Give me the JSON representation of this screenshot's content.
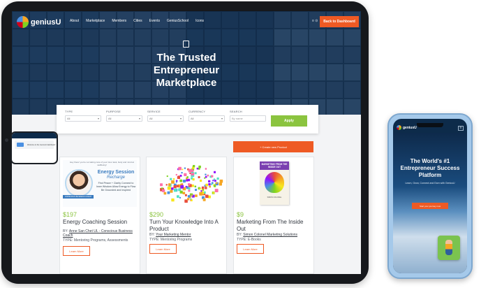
{
  "tablet": {
    "nav": {
      "logo_text": "geniusU",
      "links": [
        "About",
        "Marketplace",
        "Members",
        "Cities",
        "Events",
        "GeniusSchool",
        "Icons"
      ],
      "icons_text": "≡  ⊙",
      "cta_label": "Back to Dashboard"
    },
    "hero": {
      "title_lines": [
        "The Trusted",
        "Entrepreneur",
        "Marketplace"
      ]
    },
    "filters": {
      "type": {
        "label": "TYPE",
        "value": "All"
      },
      "purpose": {
        "label": "PURPOSE",
        "value": "All"
      },
      "service": {
        "label": "SERVICE",
        "value": "All"
      },
      "currency": {
        "label": "CURRENCY",
        "value": "All"
      },
      "search": {
        "label": "SEARCH",
        "placeholder": "By name"
      },
      "apply_label": "Apply"
    },
    "create_label": "+ Create new Product",
    "products": [
      {
        "price": "$197",
        "title": "Energy Coaching Session",
        "by_label": "BY:",
        "author": "Anne San Chet UL - Conscious Business Coach",
        "type": "TYPE: Mentoring Programs, Assessments",
        "learn_more": "Learn More",
        "image": {
          "top_text": "Hey there! you're not taking care of your inner task, body and mind at wellbeing!",
          "heading": "Energy Session",
          "subheading": "Recharge",
          "body": "Find Peace + Clarity Connect to Inner Wisdom Allow Energy to Flow Be Grounded and Inspired",
          "bar_text": "CONSCIOUS BUSINESS COACH"
        }
      },
      {
        "price": "$290",
        "title": "Turn Your Knowledge Into A Product",
        "by_label": "BY:",
        "author": "Your Marketing Mentor",
        "type": "TYPE: Mentoring Programs",
        "learn_more": "Learn More"
      },
      {
        "price": "$9",
        "title": "Marketing From The Inside Out",
        "by_label": "BY:",
        "author": "Simon Colonel Marketing Solutions",
        "type": "TYPE: E-Books",
        "learn_more": "Learn More",
        "image": {
          "book_band": "MARKETING FROM THE INSIDE OUT",
          "book_foot": "SIMON COLONEL"
        }
      }
    ]
  },
  "phone": {
    "logo_text": "geniusU",
    "menu_icon": "≡",
    "title_lines": [
      "The World's #1",
      "Entrepreneur Success",
      "Platform"
    ],
    "subtitle": "Learn, Grow, Connect and Earn with GeniusU",
    "cta_label": "Start your journey now",
    "inner_text": "Welcome to the GeniusU dashboard"
  },
  "colors": {
    "accent_orange": "#ee5a24",
    "accent_green": "#8bc43f",
    "hero_blue": "#1d3b5a"
  }
}
